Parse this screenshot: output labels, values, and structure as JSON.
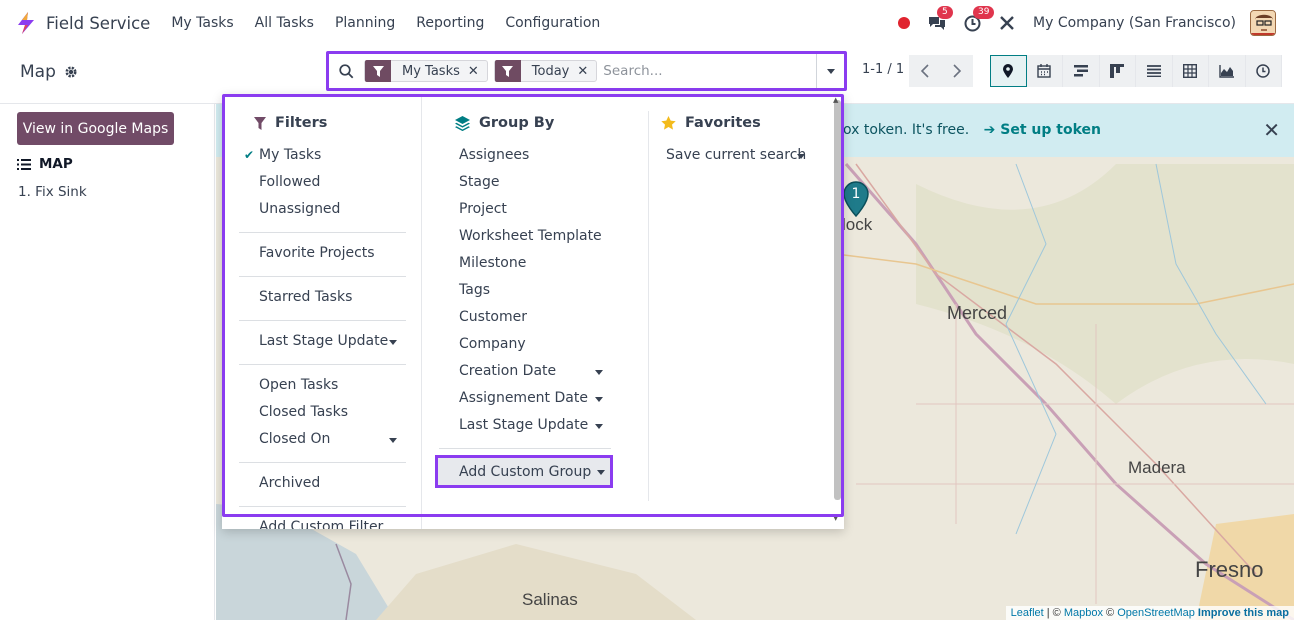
{
  "navbar": {
    "app_name": "Field Service",
    "menu": [
      "My Tasks",
      "All Tasks",
      "Planning",
      "Reporting",
      "Configuration"
    ],
    "messages_badge": "5",
    "activities_badge": "39",
    "company": "My Company (San Francisco)"
  },
  "control_panel": {
    "breadcrumb": "Map",
    "facets": [
      {
        "label": "My Tasks"
      },
      {
        "label": "Today"
      }
    ],
    "search_placeholder": "Search...",
    "pager": "1-1 / 1",
    "views": [
      "map",
      "calendar",
      "gantt",
      "kanban",
      "list",
      "pivot",
      "graph",
      "activity"
    ]
  },
  "left_panel": {
    "google_maps_button": "View in Google Maps",
    "map_header": "MAP",
    "records": [
      "1. Fix Sink"
    ]
  },
  "alert": {
    "text": "ox token. It's free.",
    "link": "Set up token"
  },
  "map": {
    "labels": {
      "lock": "lock",
      "merced": "Merced",
      "madera": "Madera",
      "fresno": "Fresno",
      "salinas": "Salinas"
    },
    "marker": "1",
    "attribution": {
      "leaflet": "Leaflet",
      "sep1": " | © ",
      "mapbox": "Mapbox",
      "sep2": " © ",
      "osm": "OpenStreetMap",
      "improve": "Improve this map"
    }
  },
  "filters": {
    "header": "Filters",
    "items": {
      "my_tasks": "My Tasks",
      "followed": "Followed",
      "unassigned": "Unassigned",
      "favorite_projects": "Favorite Projects",
      "starred_tasks": "Starred Tasks",
      "last_stage_update": "Last Stage Update",
      "open_tasks": "Open Tasks",
      "closed_tasks": "Closed Tasks",
      "closed_on": "Closed On",
      "archived": "Archived",
      "add_custom_filter": "Add Custom Filter"
    }
  },
  "group_by": {
    "header": "Group By",
    "items": {
      "assignees": "Assignees",
      "stage": "Stage",
      "project": "Project",
      "worksheet_template": "Worksheet Template",
      "milestone": "Milestone",
      "tags": "Tags",
      "customer": "Customer",
      "company": "Company",
      "creation_date": "Creation Date",
      "assignement_date": "Assignement Date",
      "last_stage_update": "Last Stage Update"
    },
    "add_custom_group": "Add Custom Group"
  },
  "favorites": {
    "header": "Favorites",
    "save_current_search": "Save current search"
  },
  "colors": {
    "brand": "#714b67",
    "highlight": "#8b3cf0",
    "teal": "#017e84"
  }
}
